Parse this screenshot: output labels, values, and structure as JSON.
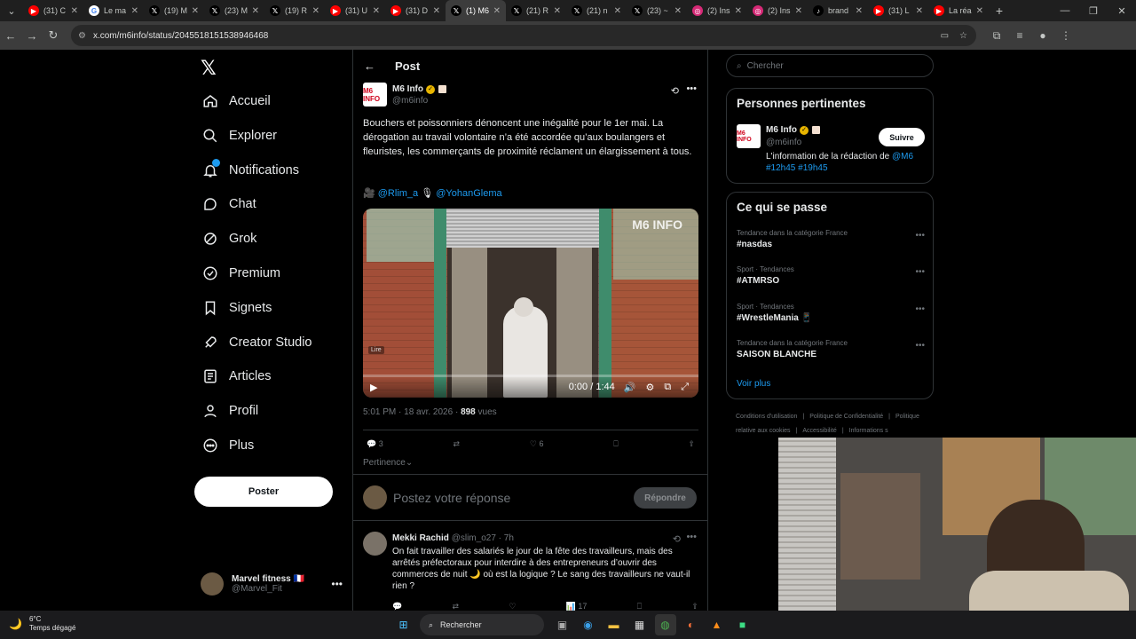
{
  "browser": {
    "tabs": [
      {
        "title": "(31) C",
        "icon": "youtube-icon",
        "color": "#ff0000",
        "glyph": "▶"
      },
      {
        "title": "Le ma",
        "icon": "google-icon",
        "color": "#ffffff",
        "glyph": "G"
      },
      {
        "title": "(19) M",
        "icon": "x-icon",
        "color": "#000000",
        "glyph": "𝕏"
      },
      {
        "title": "(23) M",
        "icon": "x-icon",
        "color": "#000000",
        "glyph": "𝕏"
      },
      {
        "title": "(19) R",
        "icon": "x-icon",
        "color": "#000000",
        "glyph": "𝕏"
      },
      {
        "title": "(31) U",
        "icon": "youtube-icon",
        "color": "#ff0000",
        "glyph": "▶"
      },
      {
        "title": "(31) D",
        "icon": "youtube-icon",
        "color": "#ff0000",
        "glyph": "▶"
      },
      {
        "title": "(1) M6",
        "icon": "x-icon",
        "color": "#000000",
        "glyph": "𝕏",
        "active": true
      },
      {
        "title": "(21) R",
        "icon": "x-icon",
        "color": "#000000",
        "glyph": "𝕏"
      },
      {
        "title": "(21) n",
        "icon": "x-icon",
        "color": "#000000",
        "glyph": "𝕏"
      },
      {
        "title": "(23) ~",
        "icon": "x-icon",
        "color": "#000000",
        "glyph": "𝕏"
      },
      {
        "title": "(2) Ins",
        "icon": "instagram-icon",
        "color": "#d62976",
        "glyph": "◎"
      },
      {
        "title": "(2) Ins",
        "icon": "instagram-icon",
        "color": "#d62976",
        "glyph": "◎"
      },
      {
        "title": "brand",
        "icon": "tiktok-icon",
        "color": "#000000",
        "glyph": "♪"
      },
      {
        "title": "(31) L",
        "icon": "youtube-icon",
        "color": "#ff0000",
        "glyph": "▶"
      },
      {
        "title": "La réa",
        "icon": "youtube-icon",
        "color": "#ff0000",
        "glyph": "▶"
      }
    ],
    "url": "x.com/m6info/status/2045518151538946468"
  },
  "nav": {
    "items": [
      {
        "label": "Accueil",
        "icon": "home-icon"
      },
      {
        "label": "Explorer",
        "icon": "search-icon"
      },
      {
        "label": "Notifications",
        "icon": "bell-icon"
      },
      {
        "label": "Chat",
        "icon": "chat-bubble-icon"
      },
      {
        "label": "Grok",
        "icon": "grok-icon"
      },
      {
        "label": "Premium",
        "icon": "premium-icon"
      },
      {
        "label": "Signets",
        "icon": "bookmark-icon"
      },
      {
        "label": "Creator Studio",
        "icon": "rocket-icon"
      },
      {
        "label": "Articles",
        "icon": "article-icon"
      },
      {
        "label": "Profil",
        "icon": "person-icon"
      },
      {
        "label": "Plus",
        "icon": "more-circle-icon"
      }
    ],
    "post_button": "Poster",
    "account": {
      "name": "Marvel fitness 🇫🇷",
      "handle": "@Marvel_Fit"
    }
  },
  "post": {
    "header": "Post",
    "author": {
      "name": "M6 Info",
      "handle": "@m6info",
      "avatar_text": "M6 INFO"
    },
    "text": "Bouchers et poissonniers dénoncent une inégalité pour le 1er mai. La dérogation au travail volontaire n’a été accordée qu’aux boulangers et fleuristes, les commerçants de proximité réclament un élargissement à tous.",
    "credit_1": "@Rlim_a",
    "credit_2": "@YohanGlema",
    "video": {
      "logo": "M6 INFO",
      "badge": "Lire",
      "time": "0:00 / 1:44",
      "progress": 0
    },
    "timestamp": "5:01 PM · 18 avr. 2026 · ",
    "views": "898",
    "views_label": " vues",
    "replies": "3",
    "likes": "6",
    "sort": "Pertinence",
    "reply_placeholder": "Postez votre réponse",
    "reply_button": "Répondre"
  },
  "reply": {
    "name": "Mekki Rachid",
    "handle_time": "@slim_o27 · 7h",
    "text": "On fait travailler des salariés le jour de la fête des travailleurs, mais des arrêtés préfectoraux pour interdire à des entrepreneurs d’ouvrir des commerces de nuit 🌙 où est la logique ? Le sang des travailleurs ne vaut-il rien ?",
    "views": "17"
  },
  "sidebar": {
    "search_placeholder": "Chercher",
    "people_title": "Personnes pertinentes",
    "person": {
      "name": "M6 Info",
      "handle": "@m6info",
      "follow": "Suivre",
      "bio": "L'information de la rédaction de ",
      "bio_link": "@M6 #12h45 #19h45"
    },
    "trends_title": "Ce qui se passe",
    "trends": [
      {
        "context": "Tendance dans la catégorie France",
        "topic": "#nasdas"
      },
      {
        "context": "Sport · Tendances",
        "topic": "#ATMRSO"
      },
      {
        "context": "Sport · Tendances",
        "topic": "#WrestleMania 📱"
      },
      {
        "context": "Tendance dans la catégorie France",
        "topic": "SAISON BLANCHE"
      }
    ],
    "see_more": "Voir plus",
    "footer": [
      "Conditions d'utilisation",
      "Politique de Confidentialité",
      "Politique relative aux cookies",
      "Accessibilité",
      "Informations s"
    ]
  },
  "taskbar": {
    "temperature": "6°C",
    "weather": "Temps dégagé",
    "search": "Rechercher"
  },
  "colors": {
    "accent": "#1d9bf0",
    "verified": "#e8b500",
    "bg": "#000000"
  }
}
